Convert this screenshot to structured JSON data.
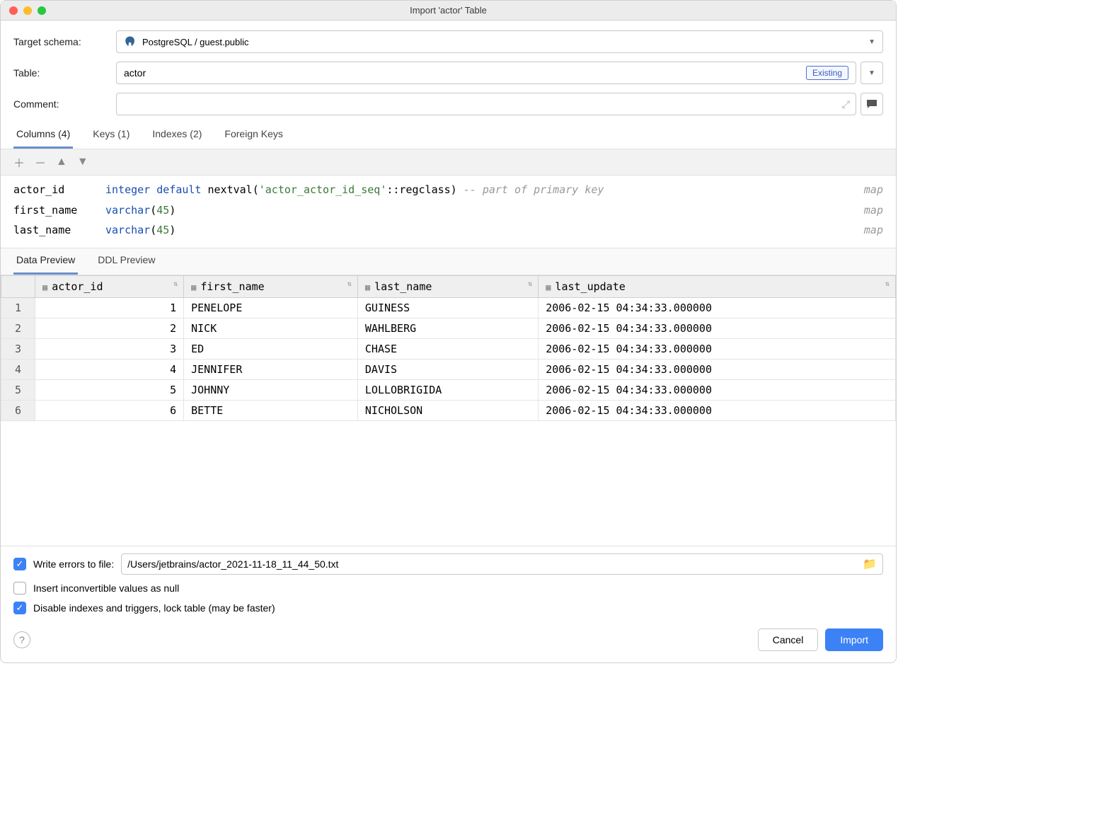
{
  "window_title": "Import 'actor' Table",
  "form": {
    "schema_label": "Target schema:",
    "schema_value": "PostgreSQL / guest.public",
    "table_label": "Table:",
    "table_value": "actor",
    "table_badge": "Existing",
    "comment_label": "Comment:",
    "comment_value": ""
  },
  "main_tabs": [
    {
      "label": "Columns (4)",
      "active": true
    },
    {
      "label": "Keys (1)",
      "active": false
    },
    {
      "label": "Indexes (2)",
      "active": false
    },
    {
      "label": "Foreign Keys",
      "active": false
    }
  ],
  "columns_def": [
    {
      "name": "actor_id",
      "type_kw": "integer default",
      "func": "nextval",
      "str": "'actor_actor_id_seq'",
      "cast": "::regclass",
      "comment": "-- part of primary key",
      "map": "map"
    },
    {
      "name": "first_name",
      "type_kw": "varchar",
      "arg": "45",
      "map": "map"
    },
    {
      "name": "last_name",
      "type_kw": "varchar",
      "arg": "45",
      "map": "map"
    }
  ],
  "preview_tabs": [
    {
      "label": "Data Preview",
      "active": true
    },
    {
      "label": "DDL Preview",
      "active": false
    }
  ],
  "grid_headers": [
    "actor_id",
    "first_name",
    "last_name",
    "last_update"
  ],
  "grid_rows": [
    {
      "n": 1,
      "actor_id": 1,
      "first_name": "PENELOPE",
      "last_name": "GUINESS",
      "last_update": "2006-02-15 04:34:33.000000"
    },
    {
      "n": 2,
      "actor_id": 2,
      "first_name": "NICK",
      "last_name": "WAHLBERG",
      "last_update": "2006-02-15 04:34:33.000000"
    },
    {
      "n": 3,
      "actor_id": 3,
      "first_name": "ED",
      "last_name": "CHASE",
      "last_update": "2006-02-15 04:34:33.000000"
    },
    {
      "n": 4,
      "actor_id": 4,
      "first_name": "JENNIFER",
      "last_name": "DAVIS",
      "last_update": "2006-02-15 04:34:33.000000"
    },
    {
      "n": 5,
      "actor_id": 5,
      "first_name": "JOHNNY",
      "last_name": "LOLLOBRIGIDA",
      "last_update": "2006-02-15 04:34:33.000000"
    },
    {
      "n": 6,
      "actor_id": 6,
      "first_name": "BETTE",
      "last_name": "NICHOLSON",
      "last_update": "2006-02-15 04:34:33.000000"
    }
  ],
  "options": {
    "write_errors_label": "Write errors to file:",
    "write_errors_checked": true,
    "write_errors_path": "/Users/jetbrains/actor_2021-11-18_11_44_50.txt",
    "insert_null_label": "Insert inconvertible values as null",
    "insert_null_checked": false,
    "disable_idx_label": "Disable indexes and triggers, lock table (may be faster)",
    "disable_idx_checked": true
  },
  "buttons": {
    "cancel": "Cancel",
    "import": "Import"
  }
}
